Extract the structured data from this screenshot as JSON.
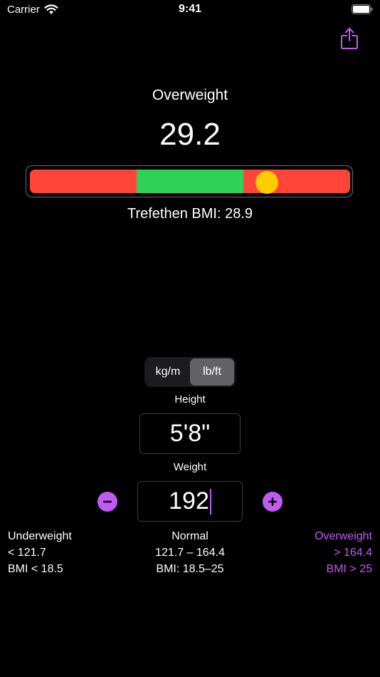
{
  "status_bar": {
    "carrier": "Carrier",
    "time": "9:41"
  },
  "result": {
    "category": "Overweight",
    "bmi": "29.2",
    "trefethen": "Trefethen BMI: 28.9"
  },
  "gauge": {
    "segments": [
      {
        "color": "#ff453a",
        "fraction": 0.3333
      },
      {
        "color": "#30d158",
        "fraction": 0.3334
      },
      {
        "color": "#ff453a",
        "fraction": 0.3333
      }
    ],
    "marker_fraction": 0.74,
    "marker_color": "#ffcc00"
  },
  "units": {
    "options": [
      "kg/m",
      "lb/ft"
    ],
    "selected": "lb/ft"
  },
  "height": {
    "label": "Height",
    "value": "5'8\""
  },
  "weight": {
    "label": "Weight",
    "value": "192"
  },
  "ranges": {
    "underweight": {
      "title": "Underweight",
      "range": "< 121.7",
      "bmi": "BMI < 18.5"
    },
    "normal": {
      "title": "Normal",
      "range": "121.7 – 164.4",
      "bmi": "BMI: 18.5–25"
    },
    "overweight": {
      "title": "Overweight",
      "range": "> 164.4",
      "bmi": "BMI > 25"
    }
  },
  "colors": {
    "accent": "#bf5af2",
    "background": "#000000"
  },
  "icons": {
    "share": "share-icon",
    "minus": "minus-icon",
    "plus": "plus-icon"
  }
}
